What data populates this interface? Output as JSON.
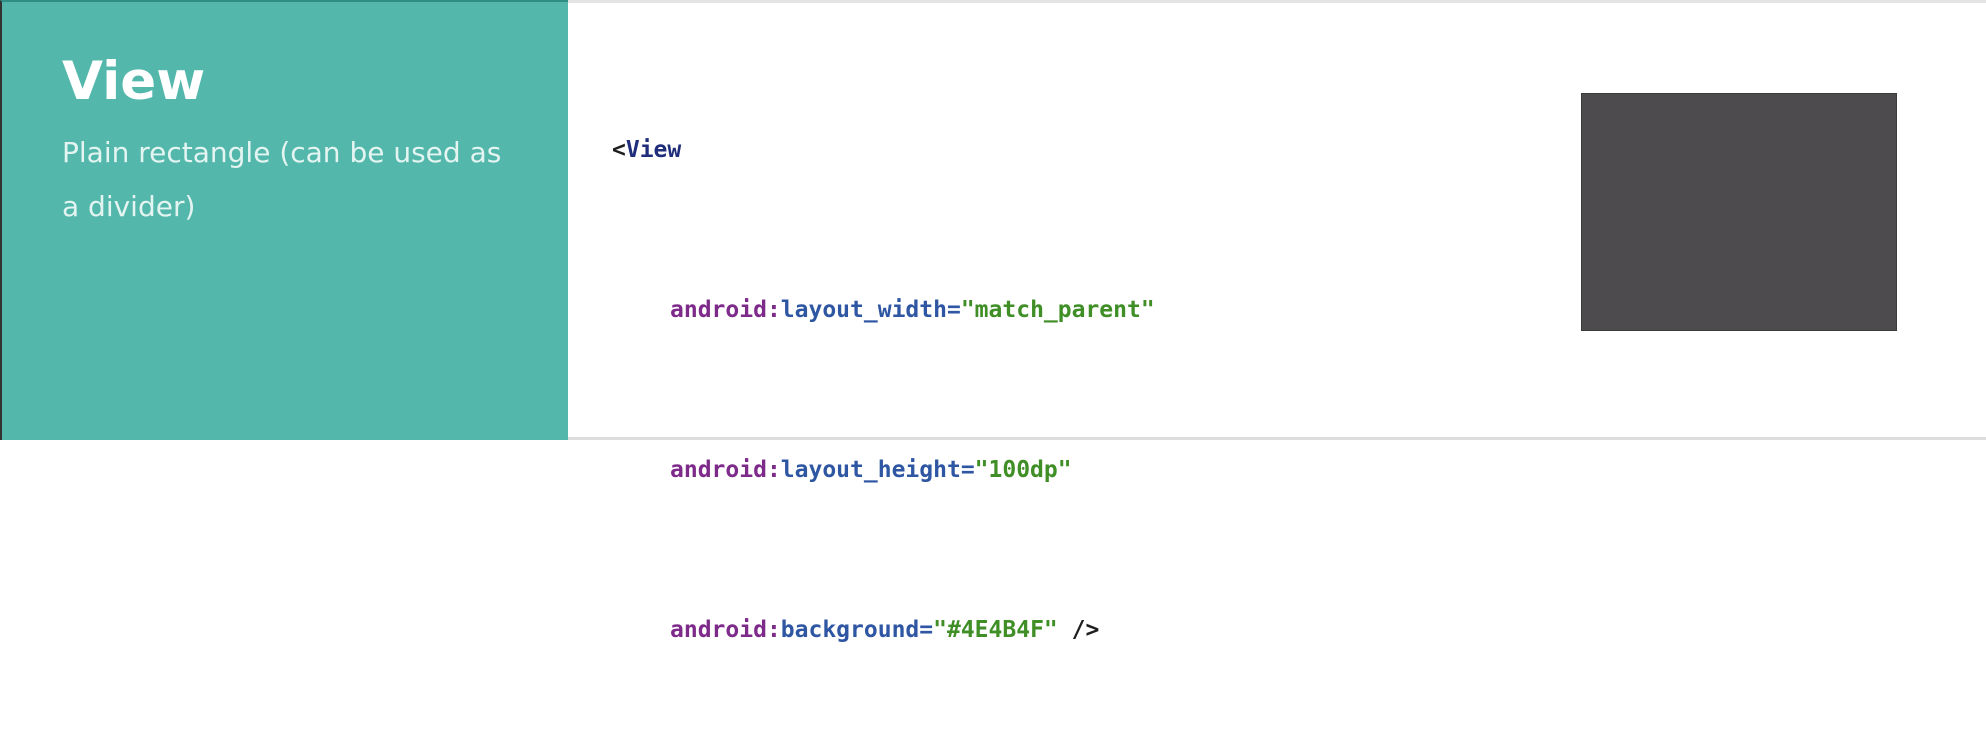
{
  "panel": {
    "title": "View",
    "subtitle": "Plain rectangle (can be used as a divider)",
    "background_color": "#53B7AB"
  },
  "code": {
    "open_bracket": "<",
    "tag": "View",
    "lines": [
      {
        "ns": "android",
        "sep": ":",
        "attr": "layout_width",
        "eq": "=",
        "value": "\"match_parent\"",
        "tail": ""
      },
      {
        "ns": "android",
        "sep": ":",
        "attr": "layout_height",
        "eq": "=",
        "value": "\"100dp\"",
        "tail": ""
      },
      {
        "ns": "android",
        "sep": ":",
        "attr": "background",
        "eq": "=",
        "value": "\"#4E4B4F\"",
        "tail": " />"
      }
    ],
    "colors": {
      "tag": "#1F2D7A",
      "namespace": "#7D2A8A",
      "attribute": "#2E56A3",
      "value": "#3F8E26"
    }
  },
  "preview": {
    "rect_color": "#4E4B4F"
  }
}
